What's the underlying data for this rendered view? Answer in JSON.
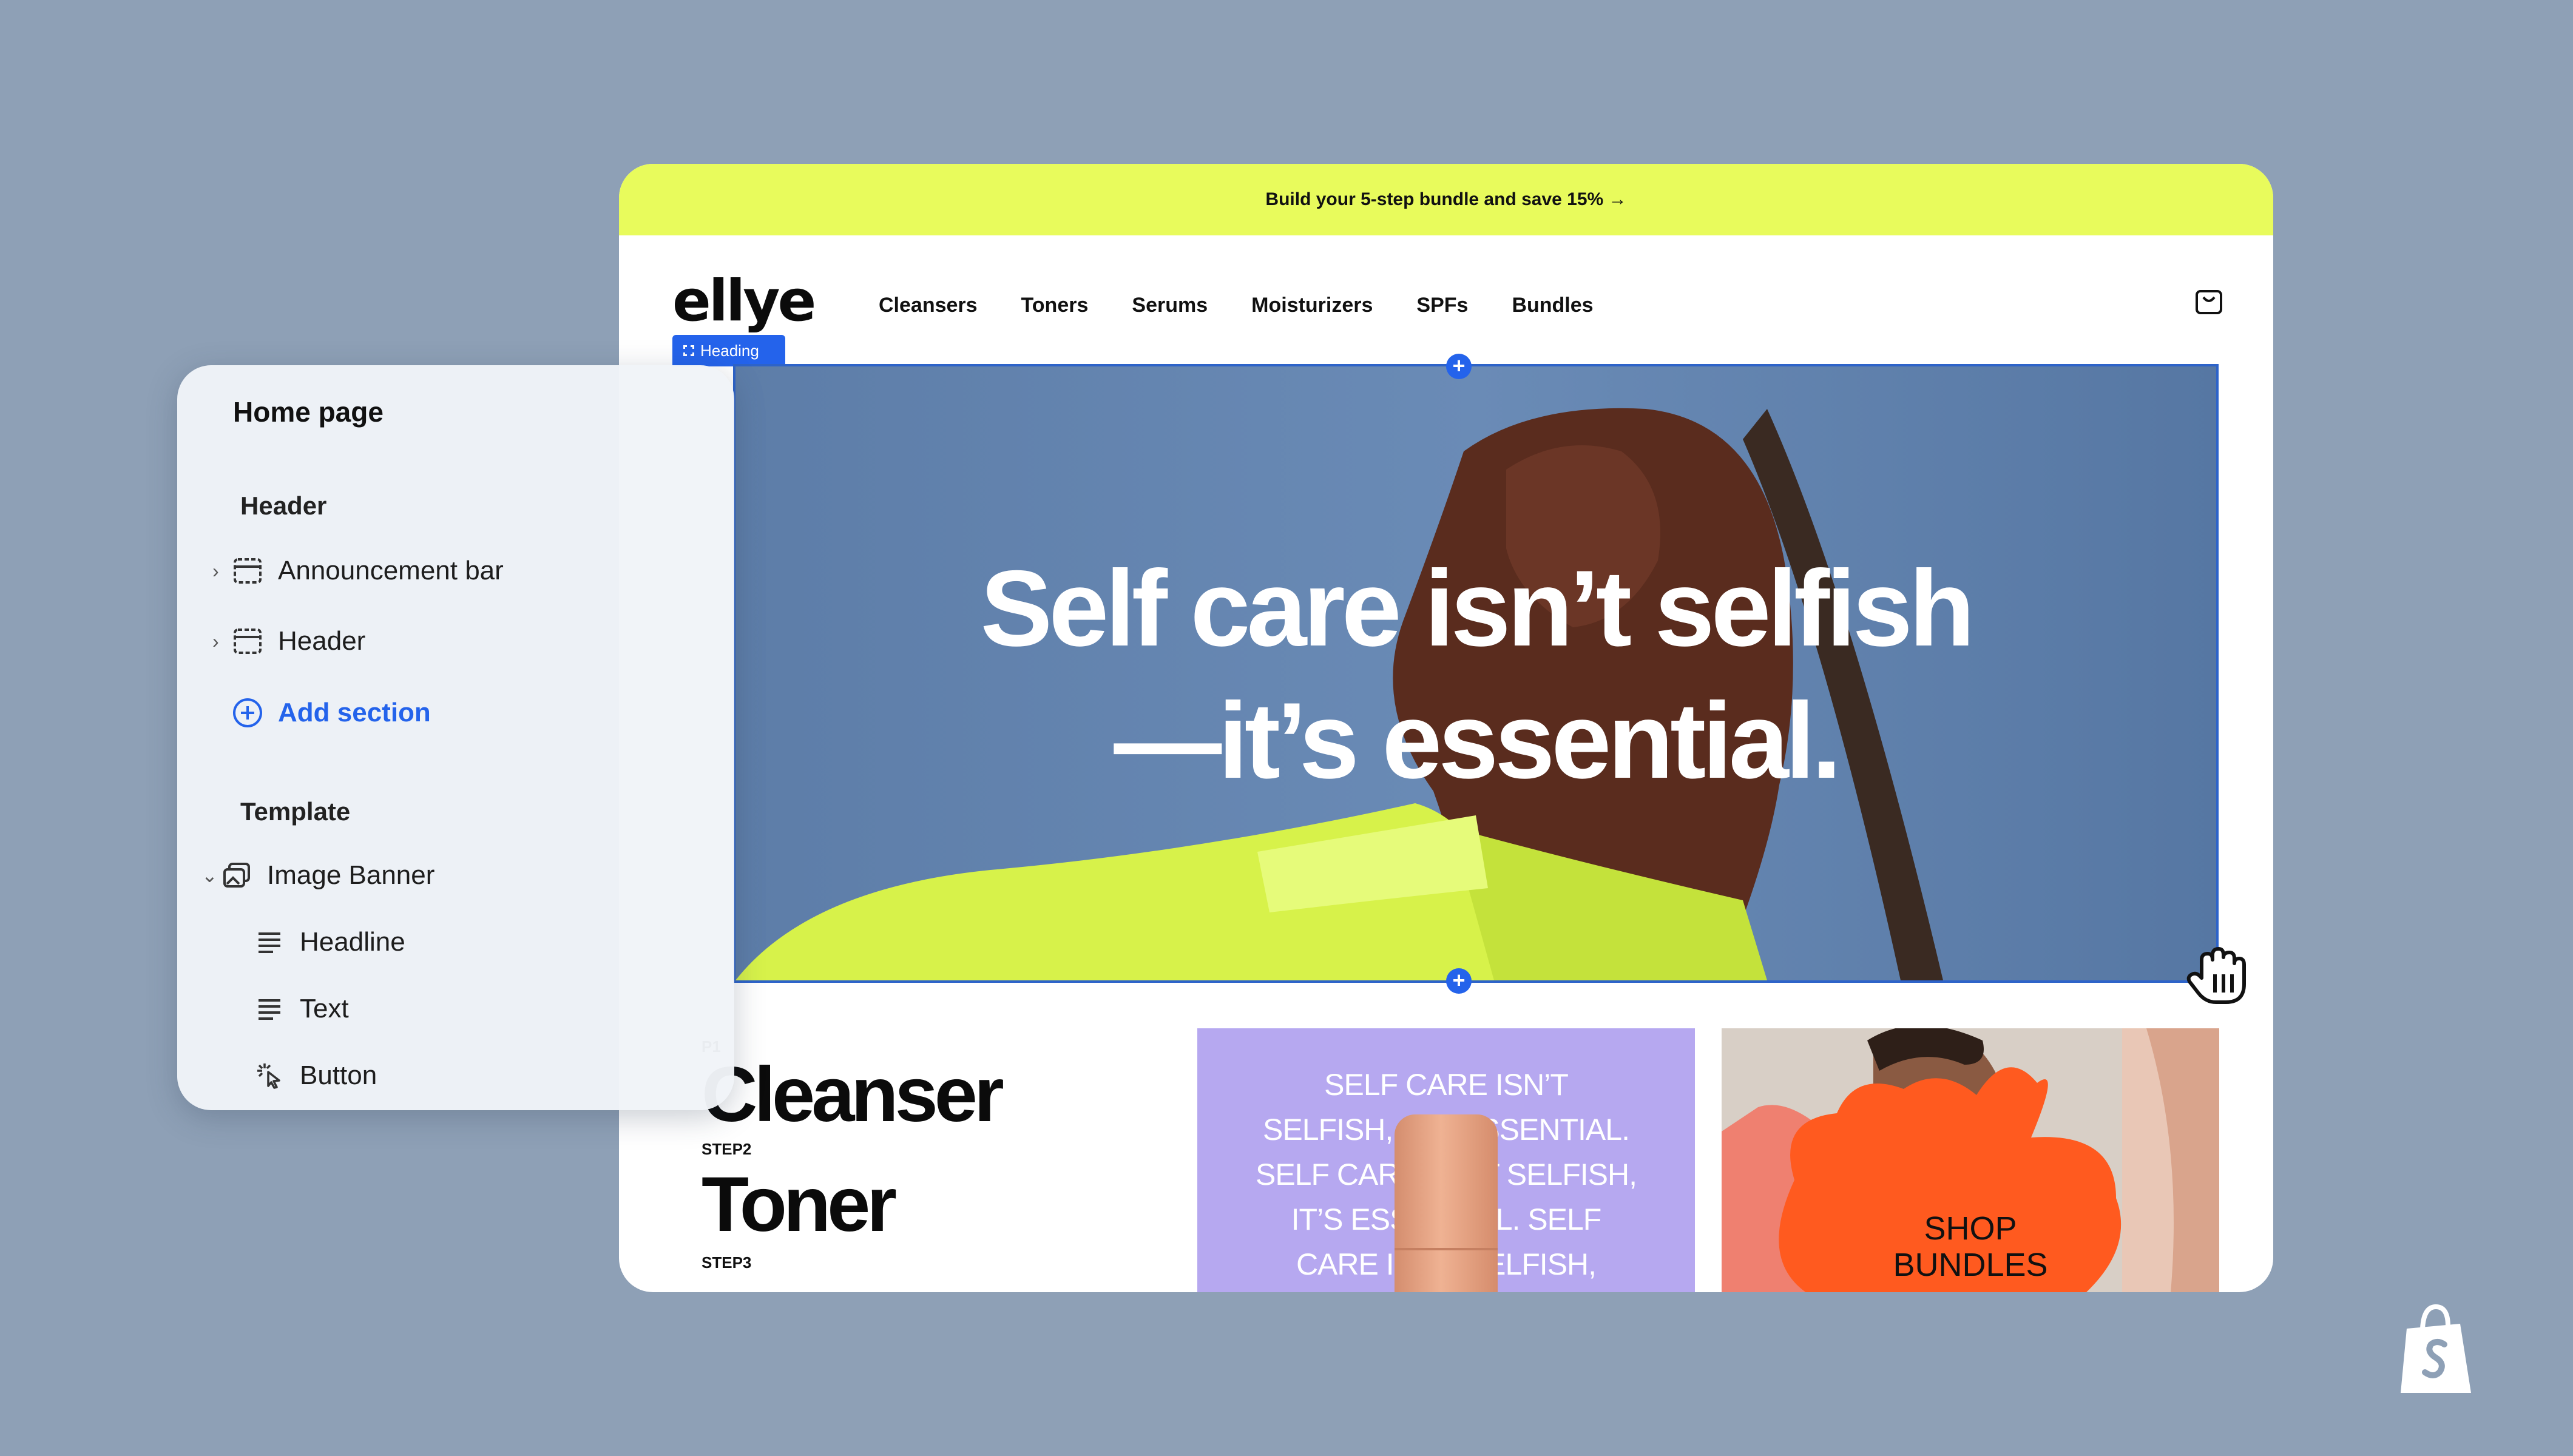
{
  "announcement": {
    "text": "Build your 5-step bundle and save 15% →"
  },
  "store": {
    "logo": "ellye",
    "nav": [
      "Cleansers",
      "Toners",
      "Serums",
      "Moisturizers",
      "SPFs",
      "Bundles"
    ],
    "cart_icon": "bag-icon",
    "selected_tag": "Heading",
    "hero": {
      "line1": "Self care isn’t selfish",
      "line2": "—it’s essential."
    },
    "steps": [
      {
        "label": "P1",
        "title": "Cleanser"
      },
      {
        "label": "STEP2",
        "title": "Toner"
      },
      {
        "label": "STEP3",
        "title": ""
      }
    ],
    "promo_text": [
      "SELF CARE ISN’T",
      "SELFISH, IT’S ESSENTIAL.",
      "SELF CARE ISN’T SELFISH,",
      "IT’S ESSENTIAL. SELF",
      "CARE ISN’T SELFISH,"
    ],
    "bundle_label": [
      "SHOP",
      "BUNDLES"
    ]
  },
  "panel": {
    "title": "Home page",
    "header_group": "Header",
    "header_items": [
      "Announcement bar",
      "Header"
    ],
    "add_section": "Add section",
    "template_group": "Template",
    "template_section": "Image Banner",
    "template_blocks": [
      "Headline",
      "Text",
      "Button"
    ]
  },
  "colors": {
    "background": "#8ea0b6",
    "announcement": "#e8fb5c",
    "selection_blue": "#2463eb",
    "promo_purple": "#b6a8f0",
    "bundle_orange": "#ff5a1f"
  }
}
